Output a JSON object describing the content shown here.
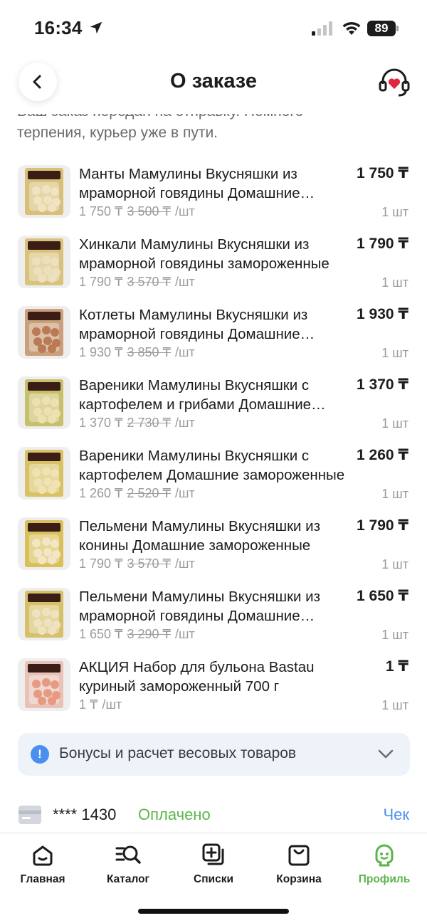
{
  "status_bar": {
    "time": "16:34",
    "battery": "89"
  },
  "header": {
    "title": "О заказе"
  },
  "intro": {
    "line1": "Ваш заказ передан на отправку. Немного",
    "line2": "терпения, курьер уже в пути."
  },
  "items": [
    {
      "name": "Манты Мамулины Вкусняшки из мраморной говядины Домашние замороженные",
      "total": "1 750 ₸",
      "price": "1 750 ₸",
      "old_price": "3 500 ₸",
      "unit": "/шт",
      "qty": "1 шт",
      "pack_color": "#d8c07a",
      "bead_color": "#f0e3c2"
    },
    {
      "name": "Хинкали Мамулины Вкусняшки из мраморной говядины замороженные",
      "total": "1 790 ₸",
      "price": "1 790 ₸",
      "old_price": "3 570 ₸",
      "unit": "/шт",
      "qty": "1 шт",
      "pack_color": "#d9c27b",
      "bead_color": "#ece0bd"
    },
    {
      "name": "Котлеты Мамулины Вкусняшки из мраморной говядины Домашние замороженные",
      "total": "1 930 ₸",
      "price": "1 930 ₸",
      "old_price": "3 850 ₸",
      "unit": "/шт",
      "qty": "1 шт",
      "pack_color": "#c9a07a",
      "bead_color": "#b97a55"
    },
    {
      "name": "Вареники Мамулины Вкусняшки с картофелем и грибами Домашние замороженные",
      "total": "1 370 ₸",
      "price": "1 370 ₸",
      "old_price": "2 730 ₸",
      "unit": "/шт",
      "qty": "1 шт",
      "pack_color": "#c7c06a",
      "bead_color": "#eee0b0"
    },
    {
      "name": "Вареники Мамулины Вкусняшки с картофелем Домашние замороженные",
      "total": "1 260 ₸",
      "price": "1 260 ₸",
      "old_price": "2 520 ₸",
      "unit": "/шт",
      "qty": "1 шт",
      "pack_color": "#d9c266",
      "bead_color": "#f0e2b2"
    },
    {
      "name": "Пельмени Мамулины Вкусняшки из конины Домашние замороженные",
      "total": "1 790 ₸",
      "price": "1 790 ₸",
      "old_price": "3 570 ₸",
      "unit": "/шт",
      "qty": "1 шт",
      "pack_color": "#d8c05a",
      "bead_color": "#f2e6c6"
    },
    {
      "name": "Пельмени Мамулины Вкусняшки из мраморной говядины Домашние замороженные",
      "total": "1 650 ₸",
      "price": "1 650 ₸",
      "old_price": "3 290 ₸",
      "unit": "/шт",
      "qty": "1 шт",
      "pack_color": "#d6c06a",
      "bead_color": "#efe2c0"
    },
    {
      "name": "АКЦИЯ Набор для бульона Bastau куриный замороженный 700 г",
      "total": "1 ₸",
      "price": "1 ₸",
      "old_price": "",
      "unit": "/шт",
      "qty": "1 шт",
      "pack_color": "#e8c2b6",
      "bead_color": "#e79a83"
    }
  ],
  "bonus": {
    "label": "Бонусы и расчет весовых товаров"
  },
  "payment": {
    "card_mask": "**** 1430",
    "status": "Оплачено",
    "receipt_label": "Чек"
  },
  "tabs": [
    {
      "label": "Главная",
      "icon": "home-icon"
    },
    {
      "label": "Каталог",
      "icon": "catalog-search-icon"
    },
    {
      "label": "Списки",
      "icon": "lists-icon"
    },
    {
      "label": "Корзина",
      "icon": "cart-bag-icon"
    },
    {
      "label": "Профиль",
      "icon": "profile-icon",
      "active": true
    }
  ],
  "colors": {
    "accent_green": "#5ab54a",
    "link_blue": "#4a8ff0",
    "muted": "#9a9aa0",
    "support_red": "#e0263c"
  }
}
